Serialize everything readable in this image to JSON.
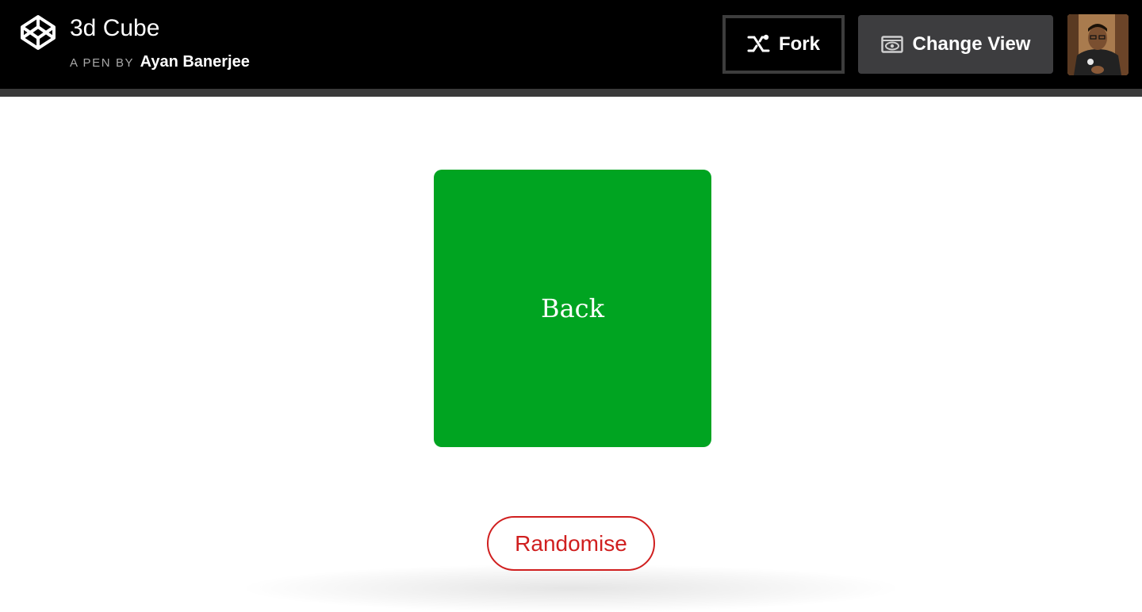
{
  "header": {
    "title": "3d Cube",
    "byline_prefix": "A PEN BY",
    "author": "Ayan Banerjee",
    "fork_label": "Fork",
    "change_view_label": "Change View"
  },
  "main": {
    "cube_face_label": "Back",
    "randomise_label": "Randomise"
  },
  "colors": {
    "cube_face": "#00a421",
    "randomise_accent": "#d01f1f",
    "topbar": "#000000"
  },
  "icons": [
    "codepen-logo-icon",
    "fork-icon",
    "eye-icon"
  ]
}
